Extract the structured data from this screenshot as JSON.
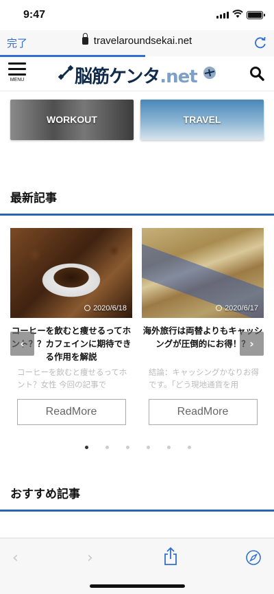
{
  "status_bar": {
    "time": "9:47"
  },
  "browser": {
    "done_label": "完了",
    "url": "travelaroundsekai.net",
    "reload_icon": "reload-icon",
    "load_progress": 0.53
  },
  "header": {
    "menu_label": "MENU",
    "logo_text": "脳筋ケンタ",
    "logo_suffix": ".net",
    "search_icon": "search-icon"
  },
  "categories": [
    {
      "label": "WORKOUT"
    },
    {
      "label": "TRAVEL"
    }
  ],
  "latest": {
    "title": "最新記事",
    "articles": [
      {
        "date": "2020/6/18",
        "title": "コーヒーを飲むと痩せるってホント？？カフェインに期待できる作用を解説",
        "excerpt": "コーヒーを飲むと痩せるってホント？女性 今回の記事で",
        "button": "ReadMore"
      },
      {
        "date": "2020/6/17",
        "title": "海外旅行は両替よりもキャッシングが圧倒的にお得！？",
        "excerpt": "結論：キャッシングかなりお得です。「どう現地通貨を用",
        "button": "ReadMore"
      }
    ],
    "carousel": {
      "prev": "‹",
      "next": "›",
      "page_count": 6,
      "active_index": 0
    }
  },
  "recommended": {
    "title": "おすすめ記事"
  },
  "toolbar": {
    "back": "‹",
    "forward": "›"
  }
}
